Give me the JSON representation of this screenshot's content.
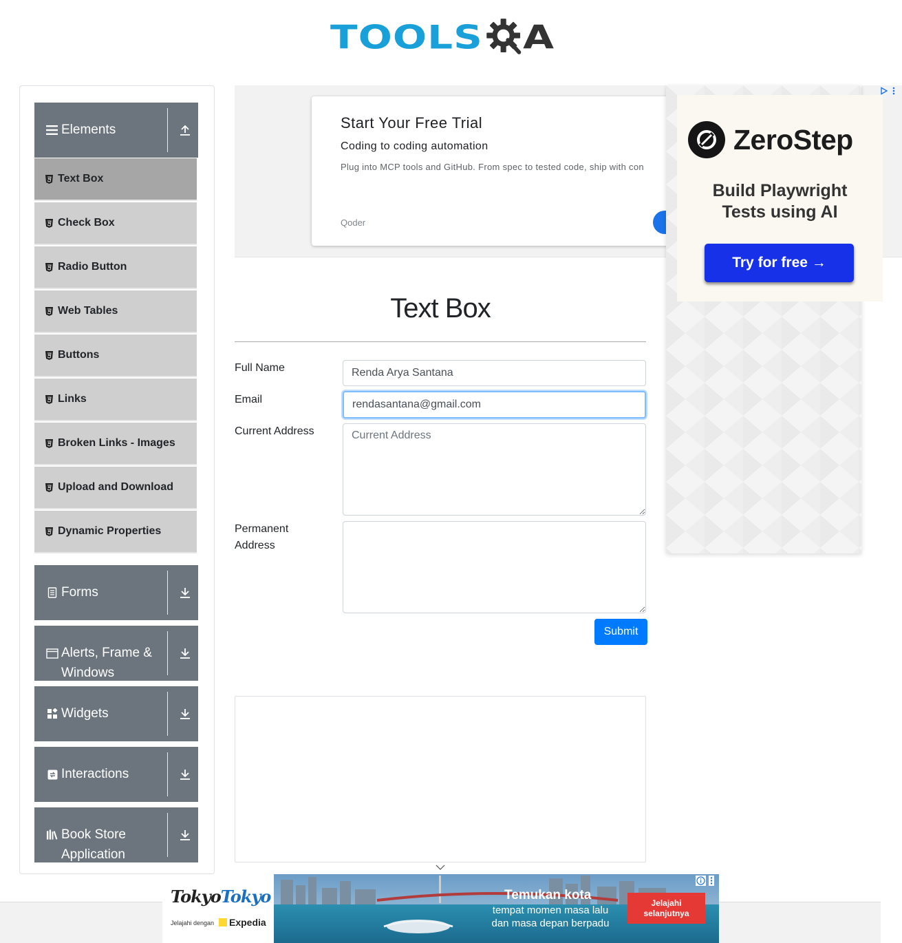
{
  "header": {
    "logo_text_left": "TOOLS",
    "logo_text_right": "A"
  },
  "sidebar": {
    "groups": [
      {
        "label": "Elements",
        "icon": "hamburger-icon",
        "expanded": true
      },
      {
        "label": "Forms",
        "icon": "document-icon",
        "expanded": false
      },
      {
        "label": "Alerts, Frame & Windows",
        "icon": "window-icon",
        "expanded": false
      },
      {
        "label": "Widgets",
        "icon": "widgets-icon",
        "expanded": false
      },
      {
        "label": "Interactions",
        "icon": "interactions-icon",
        "expanded": false
      },
      {
        "label": "Book Store Application",
        "icon": "books-icon",
        "expanded": false
      }
    ],
    "items": [
      {
        "label": "Text Box",
        "active": true
      },
      {
        "label": "Check Box",
        "active": false
      },
      {
        "label": "Radio Button",
        "active": false
      },
      {
        "label": "Web Tables",
        "active": false
      },
      {
        "label": "Buttons",
        "active": false
      },
      {
        "label": "Links",
        "active": false
      },
      {
        "label": "Broken Links - Images",
        "active": false
      },
      {
        "label": "Upload and Download",
        "active": false
      },
      {
        "label": "Dynamic Properties",
        "active": false
      }
    ]
  },
  "ad_top": {
    "title": "Start Your Free Trial",
    "subtitle": "Coding to coding automation",
    "description": "Plug into MCP tools and GitHub. From spec to tested code, ship with con",
    "brand": "Qoder"
  },
  "ad_right": {
    "brand": "ZeroStep",
    "tagline_line1": "Build Playwright",
    "tagline_line2": "Tests using AI",
    "cta": "Try for free →"
  },
  "main": {
    "title": "Text Box",
    "form": {
      "full_name_label": "Full Name",
      "full_name_value": "Renda Arya Santana",
      "email_label": "Email",
      "email_value": "rendasantana@gmail.com",
      "current_address_label": "Current Address",
      "current_address_placeholder": "Current Address",
      "permanent_address_label_line1": "Permanent",
      "permanent_address_label_line2": "Address",
      "submit_label": "Submit"
    }
  },
  "ad_bottom": {
    "brand_a": "Tokyo",
    "brand_b": "Tokyo",
    "partner_text": "Jelajahi dengan",
    "partner": "Expedia",
    "headline": "Temukan kota",
    "sub_line1": "tempat momen masa lalu",
    "sub_line2": "dan masa depan berpadu",
    "cta_line1": "Jelajahi",
    "cta_line2": "selanjutnya"
  },
  "colors": {
    "sidebar_header": "#6c757d",
    "sidebar_item": "#cfcfcf",
    "sidebar_item_active": "#a6a6a6",
    "primary_button": "#007bff",
    "logo_blue": "#1aa0d8",
    "zerostep_button": "#1631e8"
  }
}
